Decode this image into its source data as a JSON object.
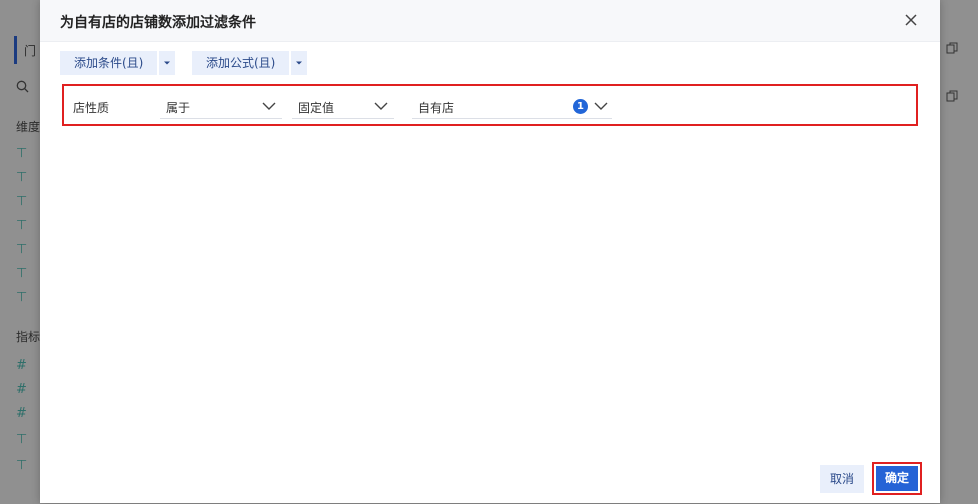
{
  "background": {
    "panel_title": "门",
    "search_icon": "search-icon",
    "section_dimension": "维度",
    "section_metric": "指标",
    "dimension_icons": [
      "⊤",
      "⊤",
      "⊤",
      "⊤",
      "⊤",
      "⊤",
      "⊤"
    ],
    "metric_icons": [
      "#",
      "#",
      "#",
      "⊤",
      "⊤"
    ]
  },
  "dialog": {
    "title": "为自有店的店铺数添加过滤条件",
    "add_condition_label": "添加条件(且)",
    "add_formula_label": "添加公式(且)",
    "condition": {
      "field": "店性质",
      "operator": "属于",
      "value_type": "固定值",
      "value": "自有店",
      "selected_count": "1"
    },
    "cancel_label": "取消",
    "ok_label": "确定"
  },
  "colors": {
    "primary": "#2563d6",
    "light_button": "#e9effb",
    "highlight_border": "#e02020"
  }
}
